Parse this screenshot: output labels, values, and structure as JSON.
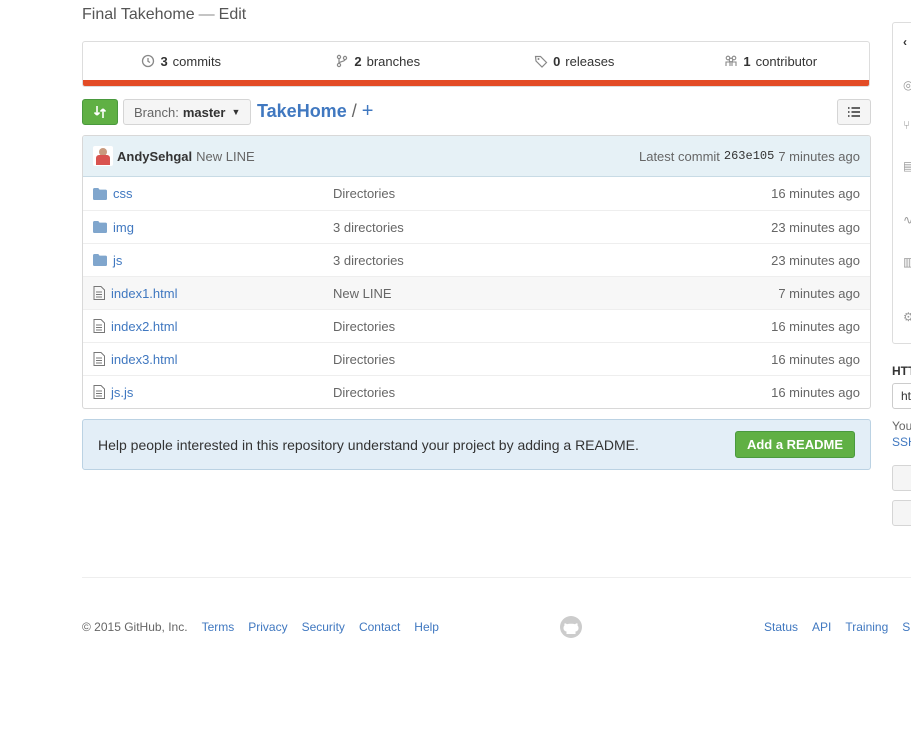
{
  "repo": {
    "description": "Final Takehome",
    "dash": "—",
    "edit_label": "Edit"
  },
  "summary": {
    "commits_count": "3",
    "commits_label": "commits",
    "branches_count": "2",
    "branches_label": "branches",
    "releases_count": "0",
    "releases_label": "releases",
    "contributors_count": "1",
    "contributors_label": "contributor",
    "language_color": "#e34c26"
  },
  "file_nav": {
    "branch_label": "Branch:",
    "branch_name": "master",
    "repo_name": "TakeHome",
    "separator": "/",
    "add_file": "+"
  },
  "commit_tease": {
    "author": "AndySehgal",
    "message": "New LINE",
    "latest_label": "Latest commit",
    "sha": "263e105",
    "age": "7 minutes ago"
  },
  "files": [
    {
      "type": "dir",
      "name": "css",
      "message": "Directories",
      "age": "16 minutes ago"
    },
    {
      "type": "dir",
      "name": "img",
      "message": "3 directories",
      "age": "23 minutes ago"
    },
    {
      "type": "dir",
      "name": "js",
      "message": "3 directories",
      "age": "23 minutes ago"
    },
    {
      "type": "file",
      "name": "index1.html",
      "message": "New LINE",
      "age": "7 minutes ago"
    },
    {
      "type": "file",
      "name": "index2.html",
      "message": "Directories",
      "age": "16 minutes ago"
    },
    {
      "type": "file",
      "name": "index3.html",
      "message": "Directories",
      "age": "16 minutes ago"
    },
    {
      "type": "file",
      "name": "js.js",
      "message": "Directories",
      "age": "16 minutes ago"
    }
  ],
  "readme": {
    "text": "Help people interested in this repository understand your project by adding a README.",
    "button": "Add a README"
  },
  "footer": {
    "copyright": "© 2015 GitHub, Inc.",
    "left_links": [
      "Terms",
      "Privacy",
      "Security",
      "Contact",
      "Help"
    ],
    "right_links": [
      "Status",
      "API",
      "Training",
      "Sh"
    ]
  },
  "sidebar": {
    "clone_label": "HTT",
    "clone_value": "ht",
    "note_text": "You",
    "note_link": "SSH"
  }
}
